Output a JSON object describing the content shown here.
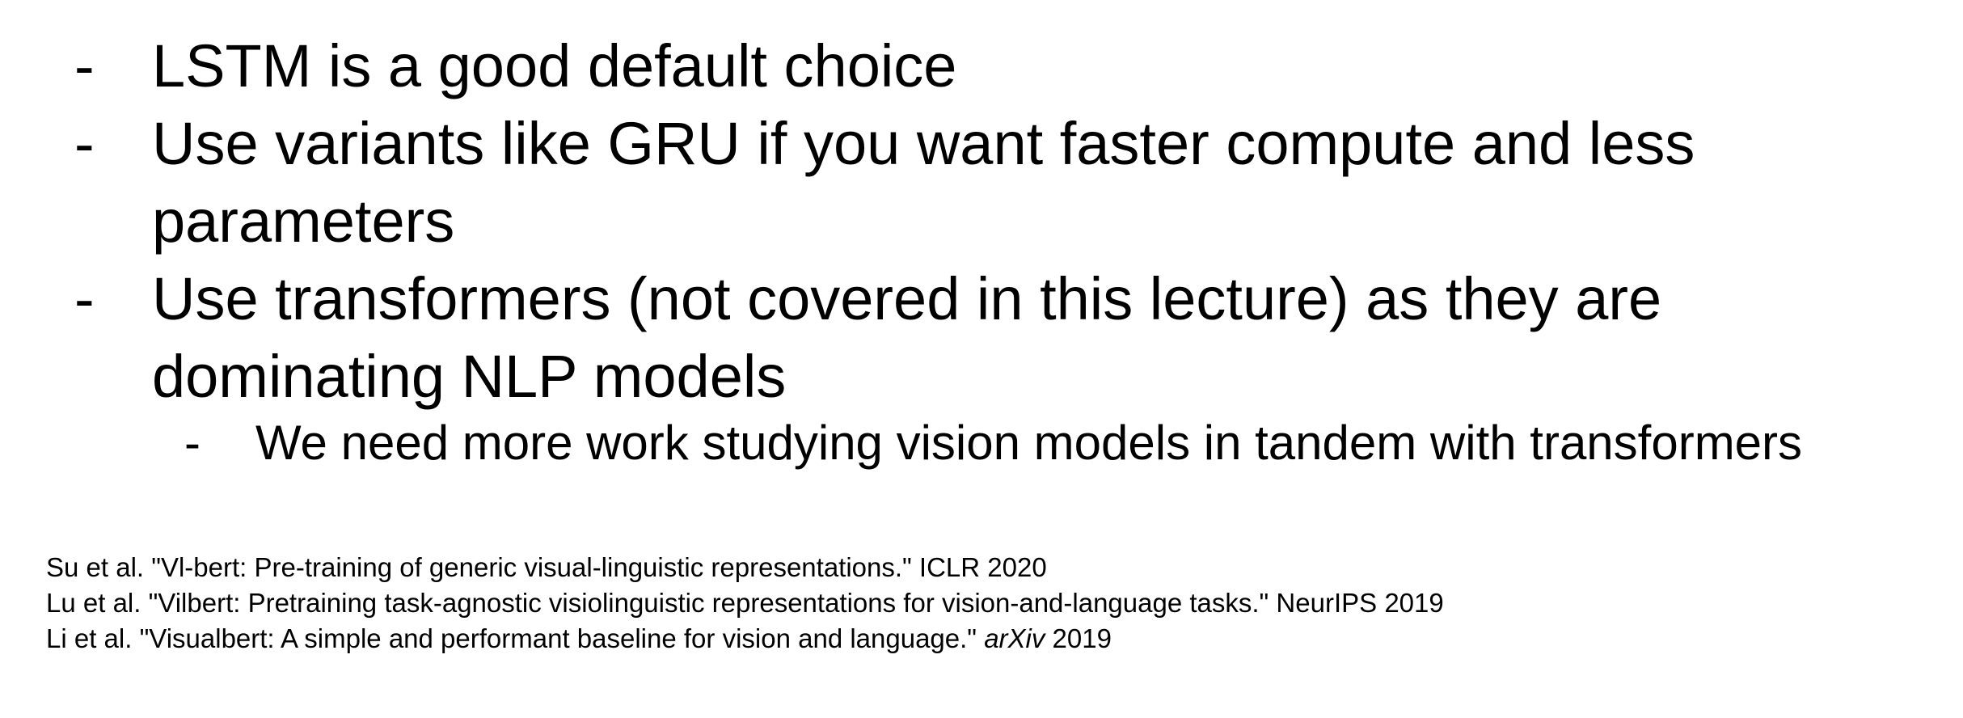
{
  "bullets": [
    {
      "dash": "-",
      "text": "LSTM is a good default choice"
    },
    {
      "dash": "-",
      "text": "Use variants like GRU if you want faster compute and less parameters"
    },
    {
      "dash": "-",
      "text": "Use transformers (not covered in this lecture) as they are dominating NLP models"
    }
  ],
  "sub_bullets": [
    {
      "dash": "-",
      "text": "We need more work studying vision models in tandem with transformers"
    }
  ],
  "references": [
    {
      "text": "Su et al. \"Vl-bert: Pre-training of generic visual-linguistic representations.\" ICLR 2020"
    },
    {
      "text": "Lu et al. \"Vilbert: Pretraining task-agnostic visiolinguistic representations for vision-and-language tasks.\" NeurIPS 2019"
    },
    {
      "text": "Li et al. \"Visualbert: A simple and performant baseline for vision and language.\" ",
      "venue": "arXiv",
      "year": " 2019"
    }
  ]
}
